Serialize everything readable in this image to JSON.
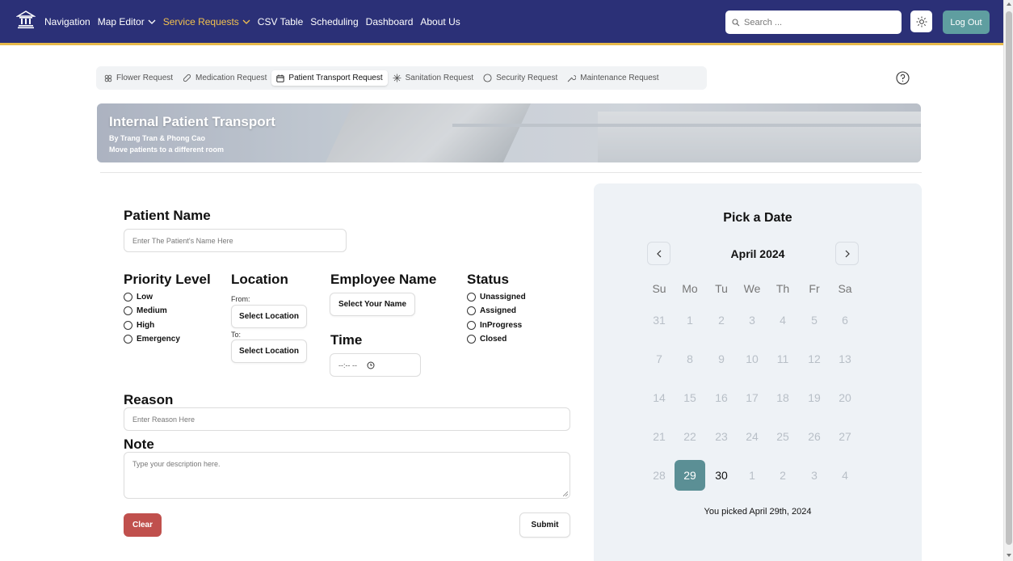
{
  "header": {
    "nav": [
      {
        "label": "Navigation",
        "dropdown": false,
        "active": false
      },
      {
        "label": "Map Editor",
        "dropdown": true,
        "active": false
      },
      {
        "label": "Service Requests",
        "dropdown": true,
        "active": true
      },
      {
        "label": "CSV Table",
        "dropdown": false,
        "active": false
      },
      {
        "label": "Scheduling",
        "dropdown": false,
        "active": false
      },
      {
        "label": "Dashboard",
        "dropdown": false,
        "active": false
      },
      {
        "label": "About Us",
        "dropdown": false,
        "active": false
      }
    ],
    "search_placeholder": "Search ...",
    "logout_label": "Log Out",
    "colors": {
      "bar": "#2b3077",
      "active": "#f2c14e",
      "accent": "#5f9ea0"
    }
  },
  "tabs": [
    {
      "label": "Flower Request",
      "icon": "flower-icon"
    },
    {
      "label": "Medication Request",
      "icon": "pill-icon"
    },
    {
      "label": "Patient Transport Request",
      "icon": "calendar-icon",
      "active": true
    },
    {
      "label": "Sanitation Request",
      "icon": "sparkle-icon"
    },
    {
      "label": "Security Request",
      "icon": "shield-icon"
    },
    {
      "label": "Maintenance Request",
      "icon": "wrench-icon"
    }
  ],
  "banner": {
    "title": "Internal Patient Transport",
    "authors": "By Trang Tran & Phong Cao",
    "description": "Move patients to a different room"
  },
  "form": {
    "patient_name": {
      "label": "Patient Name",
      "placeholder": "Enter The Patient's Name Here",
      "value": ""
    },
    "priority": {
      "label": "Priority Level",
      "options": [
        "Low",
        "Medium",
        "High",
        "Emergency"
      ],
      "selected": null
    },
    "location": {
      "label": "Location",
      "from_label": "From:",
      "to_label": "To:",
      "from_button": "Select Location",
      "to_button": "Select Location"
    },
    "employee": {
      "label": "Employee Name",
      "button": "Select Your Name"
    },
    "time": {
      "label": "Time",
      "value": "--:-- --"
    },
    "status": {
      "label": "Status",
      "options": [
        "Unassigned",
        "Assigned",
        "InProgress",
        "Closed"
      ],
      "selected": null
    },
    "reason": {
      "label": "Reason",
      "placeholder": "Enter Reason Here",
      "value": ""
    },
    "note": {
      "label": "Note",
      "placeholder": "Type your description here.",
      "value": ""
    },
    "clear_label": "Clear",
    "submit_label": "Submit"
  },
  "calendar": {
    "title": "Pick a Date",
    "month_label": "April 2024",
    "weekdays": [
      "Su",
      "Mo",
      "Tu",
      "We",
      "Th",
      "Fr",
      "Sa"
    ],
    "weeks": [
      [
        "31",
        "1",
        "2",
        "3",
        "4",
        "5",
        "6"
      ],
      [
        "7",
        "8",
        "9",
        "10",
        "11",
        "12",
        "13"
      ],
      [
        "14",
        "15",
        "16",
        "17",
        "18",
        "19",
        "20"
      ],
      [
        "21",
        "22",
        "23",
        "24",
        "25",
        "26",
        "27"
      ],
      [
        "28",
        "29",
        "30",
        "1",
        "2",
        "3",
        "4"
      ]
    ],
    "selected_day": "29",
    "current_days": [
      "29",
      "30"
    ],
    "picked_text": "You picked April 29th, 2024",
    "selected_color": "#5b8f95"
  }
}
